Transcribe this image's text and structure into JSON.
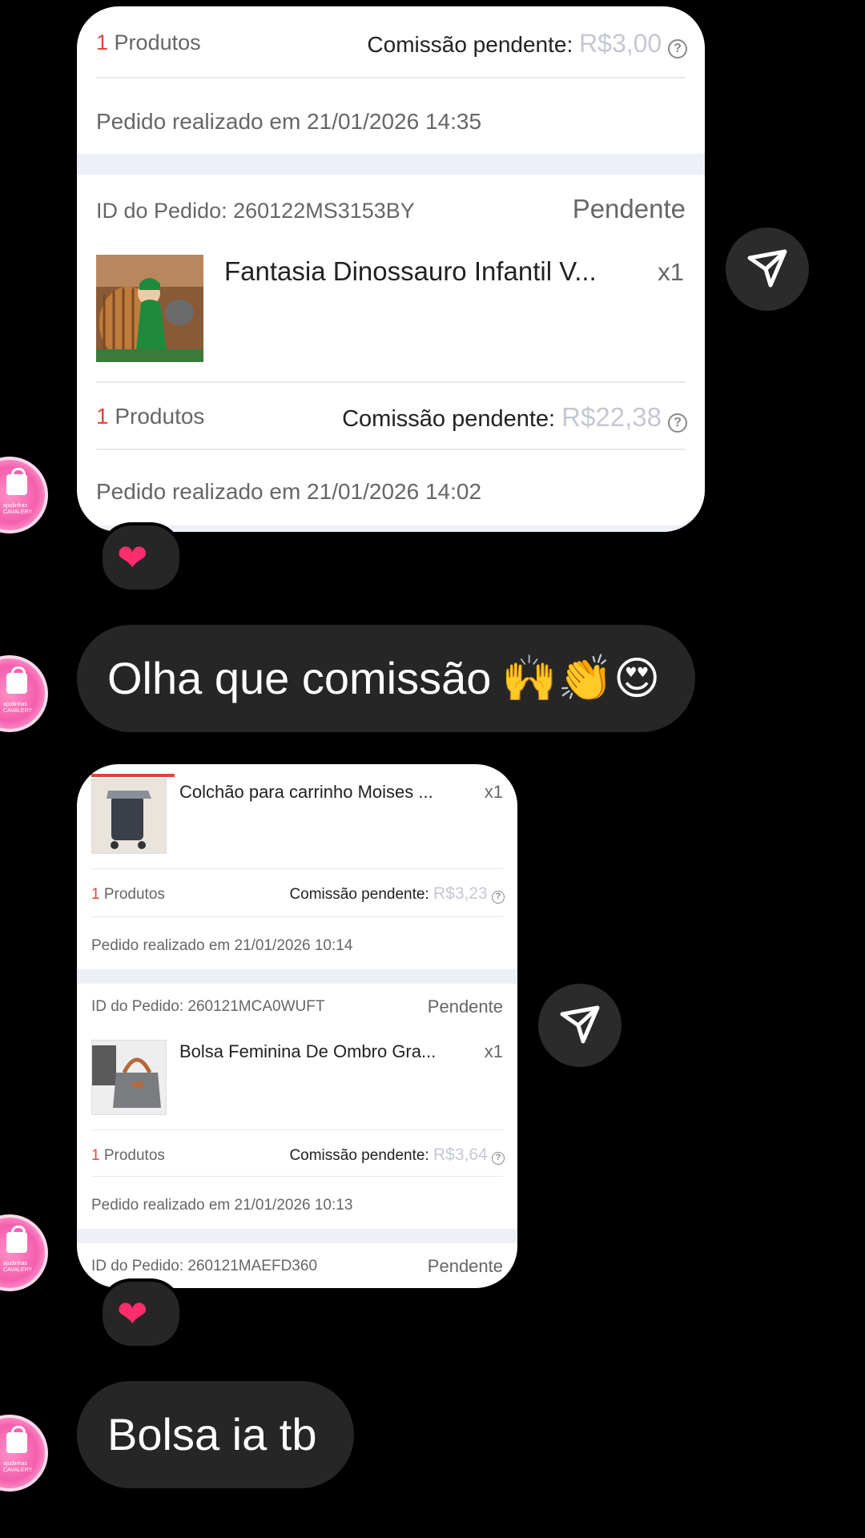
{
  "card1": {
    "top_row": {
      "qty_num": "1",
      "qty_label": "Produtos",
      "commission_label": "Comissão pendente:",
      "commission_value": "R$3,00"
    },
    "top_date": "Pedido realizado em 21/01/2026 14:35",
    "order": {
      "id_text": "ID do Pedido: 260122MS3153BY",
      "status": "Pendente",
      "product": "Fantasia Dinossauro Infantil V...",
      "qty": "x1",
      "qty_num": "1",
      "qty_label": "Produtos",
      "commission_label": "Comissão pendente:",
      "commission_value": "R$22,38",
      "date": "Pedido realizado em 21/01/2026 14:02"
    }
  },
  "msg1": "Olha que comissão",
  "msg1_emojis": [
    "🙌",
    "👏",
    "😍"
  ],
  "card2": {
    "order_a": {
      "product": "Colchão para carrinho Moises ...",
      "qty": "x1",
      "qty_num": "1",
      "qty_label": "Produtos",
      "commission_label": "Comissão pendente:",
      "commission_value": "R$3,23",
      "date": "Pedido realizado em 21/01/2026 10:14"
    },
    "order_b": {
      "id_text": "ID do Pedido: 260121MCA0WUFT",
      "status": "Pendente",
      "product": "Bolsa Feminina De Ombro Gra...",
      "qty": "x1",
      "qty_num": "1",
      "qty_label": "Produtos",
      "commission_label": "Comissão pendente:",
      "commission_value": "R$3,64",
      "date": "Pedido realizado em 21/01/2026 10:13"
    },
    "order_c": {
      "id_text": "ID do Pedido: 260121MAEFD360",
      "status": "Pendente"
    }
  },
  "msg2": "Bolsa ia tb",
  "heart": "❤",
  "avatar_text": "ajudinhas CAVALERY",
  "icons": {
    "share": "send-icon",
    "help": "question-circle-icon",
    "reaction": "heart-icon"
  },
  "colors": {
    "bubble": "#262626",
    "background": "#000000",
    "commission": "#c5c8d2",
    "qty": "#e0463c"
  }
}
